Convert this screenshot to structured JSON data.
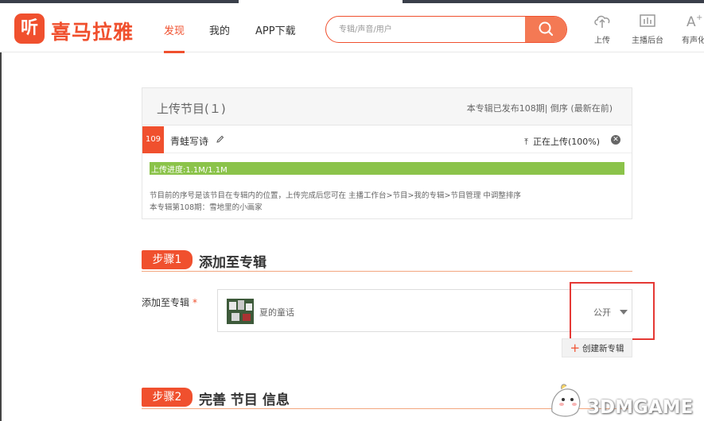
{
  "brand": {
    "logo_glyph": "听",
    "name": "喜马拉雅",
    "color": "#f0502e"
  },
  "nav": {
    "items": [
      {
        "label": "发现",
        "active": true
      },
      {
        "label": "我的"
      },
      {
        "label": "APP下载"
      }
    ]
  },
  "search": {
    "placeholder": "专辑/声音/用户"
  },
  "header_tools": [
    {
      "label": "上传",
      "icon": "upload-cloud-icon"
    },
    {
      "label": "主播后台",
      "icon": "dashboard-icon"
    },
    {
      "label": "有声化",
      "icon": "font-plus-icon"
    }
  ],
  "upload_panel": {
    "title": "上传节目(１)",
    "meta": "本专辑已发布108期| 倒序 (最新在前)",
    "track": {
      "number": "109",
      "name": "青蛙写诗",
      "status": "正在上传(100%)"
    },
    "progress": {
      "label": "上传进度:1.1M/1.1M",
      "fraction": 1.0
    },
    "note_lines": [
      "节目前的序号是该节目在专辑内的位置，上传完成后您可在 主播工作台>节目>我的专辑>节目管理 中调整排序",
      "本专辑第108期：雪地里的小画家"
    ]
  },
  "step1": {
    "badge": "步骤1",
    "title": "添加至专辑"
  },
  "album_field": {
    "label": "添加至专辑",
    "required_mark": "*",
    "album_name": "夏的童话",
    "visibility": "公开",
    "create_button": "创建新专辑"
  },
  "step2": {
    "badge": "步骤2",
    "title": "完善 节目 信息"
  },
  "watermark": {
    "text": "3DMGAME"
  }
}
